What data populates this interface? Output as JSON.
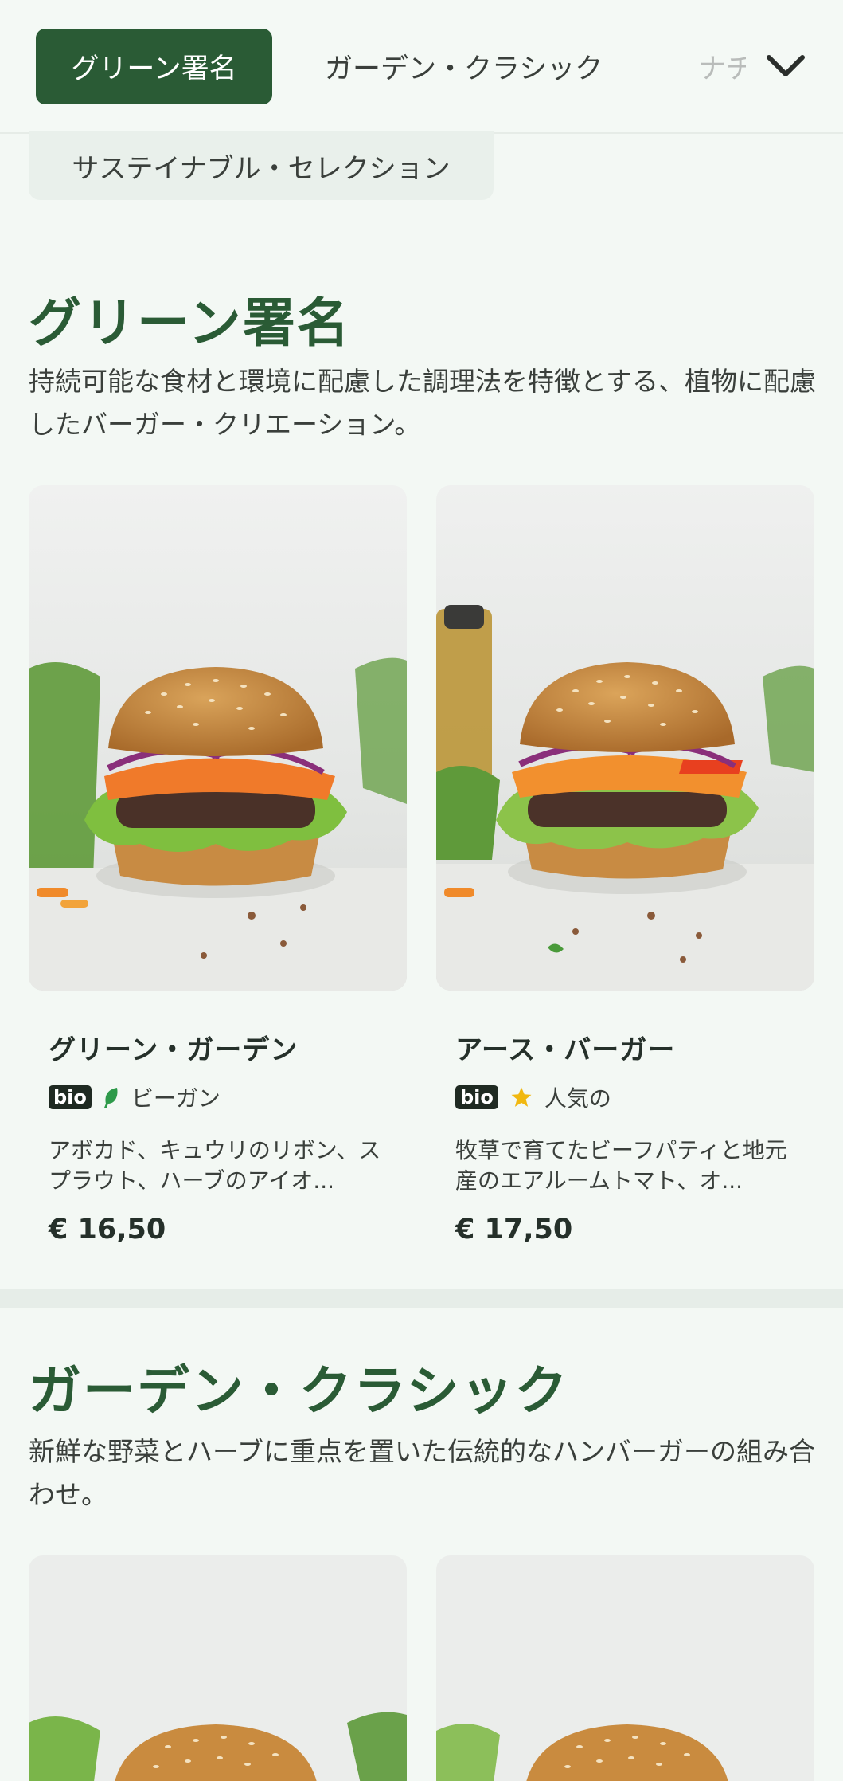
{
  "nav": {
    "tabs": [
      {
        "label": "グリーン署名",
        "active": true
      },
      {
        "label": "ガーデン・クラシック",
        "active": false
      },
      {
        "label": "ナチ",
        "active": false
      }
    ],
    "chip_label": "サステイナブル・セレクション",
    "expand_icon": "chevron-down-icon"
  },
  "sections": [
    {
      "title": "グリーン署名",
      "description": "持続可能な食材と環境に配慮した調理法を特徴とする、植物に配慮したバーガー・クリエーション。",
      "items": [
        {
          "name": "グリーン・ガーデン",
          "badge": "bio",
          "tag_icon": "leaf-icon",
          "tag": "ビーガン",
          "description": "アボカド、キュウリのリボン、スプラウト、ハーブのアイオ...",
          "price": "€ 16,50"
        },
        {
          "name": "アース・バーガー",
          "badge": "bio",
          "tag_icon": "star-icon",
          "tag": "人気の",
          "description": "牧草で育てたビーフパティと地元産のエアルームトマト、オ...",
          "price": "€ 17,50"
        }
      ]
    },
    {
      "title": "ガーデン・クラシック",
      "description": "新鮮な野菜とハーブに重点を置いた伝統的なハンバーガーの組み合わせ。"
    }
  ],
  "colors": {
    "brand_green": "#2a5b35",
    "leaf_green": "#2e9a4a",
    "star_yellow": "#f1b810",
    "background": "#f3f8f4"
  }
}
